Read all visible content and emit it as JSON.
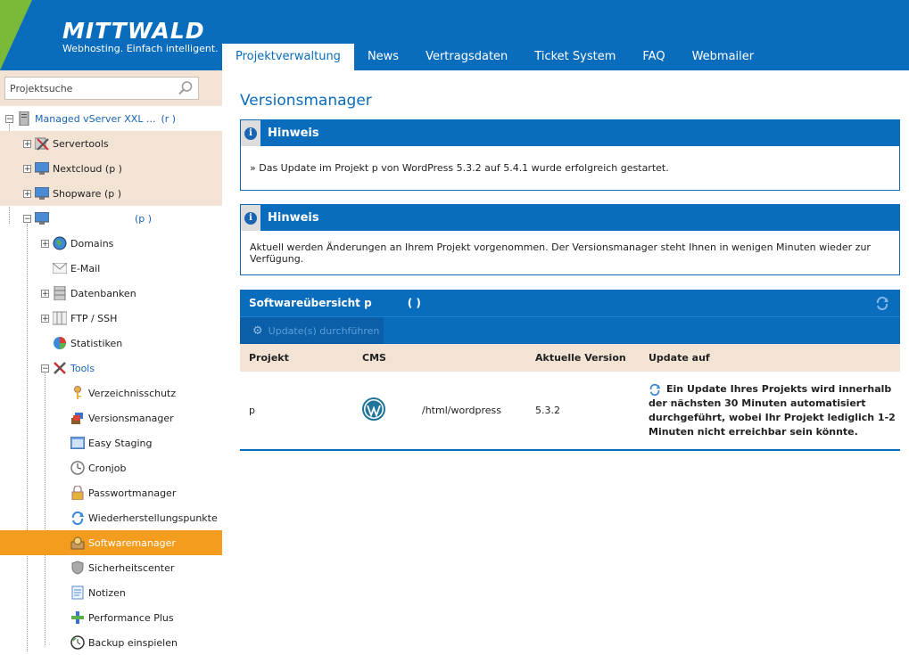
{
  "header": {
    "logo": "MITTWALD",
    "tagline": "Webhosting. Einfach intelligent.",
    "tabs": [
      {
        "label": "Projektverwaltung",
        "active": true
      },
      {
        "label": "News",
        "active": false
      },
      {
        "label": "Vertragsdaten",
        "active": false
      },
      {
        "label": "Ticket System",
        "active": false
      },
      {
        "label": "FAQ",
        "active": false
      },
      {
        "label": "Webmailer",
        "active": false
      }
    ]
  },
  "sidebar": {
    "search_placeholder": "Projektsuche",
    "tree": {
      "server": {
        "label": "Managed vServer XXL ...",
        "suffix": "(r          )"
      },
      "servertools": "Servertools",
      "nextcloud": "Nextcloud (p           )",
      "shopware": "Shopware (p           )",
      "project": {
        "label": "(p          )"
      },
      "domains": "Domains",
      "email": "E-Mail",
      "datenbanken": "Datenbanken",
      "ftp": "FTP / SSH",
      "statistiken": "Statistiken",
      "tools": "Tools",
      "tool_items": [
        {
          "label": "Verzeichnisschutz",
          "icon": "key-icon"
        },
        {
          "label": "Versionsmanager",
          "icon": "versionsmanager-icon"
        },
        {
          "label": "Easy Staging",
          "icon": "staging-icon"
        },
        {
          "label": "Cronjob",
          "icon": "cronjob-icon"
        },
        {
          "label": "Passwortmanager",
          "icon": "lock-icon"
        },
        {
          "label": "Wiederherstellungspunkte",
          "icon": "restore-icon"
        },
        {
          "label": "Softwaremanager",
          "icon": "softwaremanager-icon",
          "selected": true
        },
        {
          "label": "Sicherheitscenter",
          "icon": "shield-icon"
        },
        {
          "label": "Notizen",
          "icon": "notes-icon"
        },
        {
          "label": "Performance Plus",
          "icon": "performance-icon"
        },
        {
          "label": "Backup einspielen",
          "icon": "backup-icon"
        }
      ]
    }
  },
  "main": {
    "title": "Versionsmanager",
    "notices": [
      {
        "title": "Hinweis",
        "text": "» Das Update im Projekt p             von WordPress 5.3.2 auf 5.4.1 wurde erfolgreich gestartet."
      },
      {
        "title": "Hinweis",
        "text": "Aktuell werden Änderungen an Ihrem Projekt vorgenommen. Der Versionsmanager steht Ihnen in wenigen Minuten wieder zur Verfügung."
      }
    ],
    "software": {
      "title": "Softwareübersicht p",
      "title_paren": "(                      )",
      "update_button": "Update(s) durchführen",
      "columns": {
        "projekt": "Projekt",
        "cms": "CMS",
        "path": "",
        "version": "Aktuelle Version",
        "update": "Update auf"
      },
      "rows": [
        {
          "projekt": "p",
          "cms": "wordpress-logo",
          "path": "/html/wordpress",
          "version": "5.3.2",
          "update": "Ein Update Ihres Projekts wird innerhalb der nächsten 30 Minuten automatisiert durchgeführt, wobei Ihr Projekt lediglich 1-2 Minuten nicht erreichbar sein könnte."
        }
      ]
    }
  },
  "colors": {
    "brand_blue": "#0a6cbc",
    "brand_green": "#7ab93a",
    "selected_orange": "#f39c1e",
    "row_beige": "#f2e3d5"
  }
}
